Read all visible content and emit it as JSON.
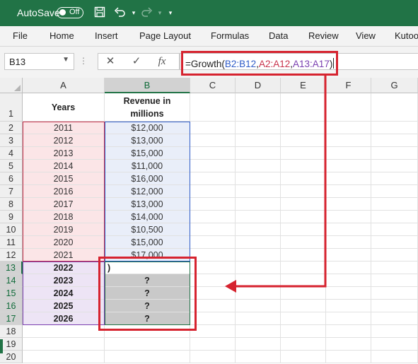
{
  "title_bar": {
    "autosave_label": "AutoSave",
    "toggle_state": "Off",
    "background": "#217346"
  },
  "menu": [
    "File",
    "Home",
    "Insert",
    "Page Layout",
    "Formulas",
    "Data",
    "Review",
    "View",
    "Kutoo"
  ],
  "formula_bar": {
    "name_box": "B13",
    "cancel_icon": "✕",
    "enter_icon": "✓",
    "fx_icon": "fx",
    "formula_prefix": "=Growth(",
    "arg1": "B2:B12",
    "comma1": ",",
    "arg2": "A2:A12",
    "comma2": ",",
    "arg3": "A13:A17",
    "formula_suffix": ")",
    "arg1_color": "#2f5cc8",
    "arg2_color": "#c8324b",
    "arg3_color": "#7a3fb0"
  },
  "columns": [
    "A",
    "B",
    "C",
    "D",
    "E",
    "F",
    "G"
  ],
  "rows": [
    "1",
    "2",
    "3",
    "4",
    "5",
    "6",
    "7",
    "8",
    "9",
    "10",
    "11",
    "12",
    "13",
    "14",
    "15",
    "16",
    "17",
    "18",
    "19",
    "20"
  ],
  "sheet": {
    "headers": {
      "years": "Years",
      "revenue": "Revenue in\nmillions"
    },
    "data": [
      {
        "year": "2011",
        "revenue": "$12,000"
      },
      {
        "year": "2012",
        "revenue": "$13,000"
      },
      {
        "year": "2013",
        "revenue": "$15,000"
      },
      {
        "year": "2014",
        "revenue": "$11,000"
      },
      {
        "year": "2015",
        "revenue": "$16,000"
      },
      {
        "year": "2016",
        "revenue": "$12,000"
      },
      {
        "year": "2017",
        "revenue": "$13,000"
      },
      {
        "year": "2018",
        "revenue": "$14,000"
      },
      {
        "year": "2019",
        "revenue": "$10,500"
      },
      {
        "year": "2020",
        "revenue": "$15,000"
      },
      {
        "year": "2021",
        "revenue": "$17,000"
      }
    ],
    "forecast": [
      {
        "year": "2022",
        "revenue": ")"
      },
      {
        "year": "2023",
        "revenue": "?"
      },
      {
        "year": "2024",
        "revenue": "?"
      },
      {
        "year": "2025",
        "revenue": "?"
      },
      {
        "year": "2026",
        "revenue": "?"
      }
    ]
  },
  "colors": {
    "annotation_red": "#d6232f",
    "range_a_fill": "#fbe5e7",
    "range_b_fill": "#e9eef9",
    "range_a13_fill": "#ede4f5",
    "forecast_fill": "#c9c9c9",
    "accent_green": "#217346"
  }
}
